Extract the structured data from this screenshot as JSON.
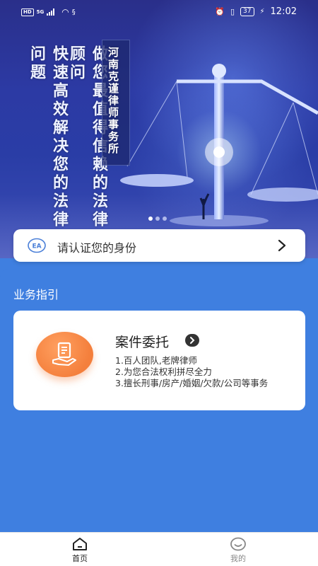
{
  "status_bar": {
    "network_badge": "HD",
    "network_type": "5G",
    "battery": "37",
    "time": "12:02"
  },
  "banner": {
    "slogan_left": "快速高效解决您的法律问题",
    "slogan_mid": "做您最值得信赖的法律顾问",
    "firm_name": "河南克谨律师事务所",
    "carousel_pages": 3,
    "carousel_active": 1
  },
  "identity": {
    "icon": "id-card-icon",
    "label": "请认证您的身份",
    "chevron_icon": "chevron-right-icon"
  },
  "business": {
    "section_title": "业务指引",
    "card": {
      "title": "案件委托",
      "icon": "document-hand-icon",
      "points": [
        "1.百人团队,老牌律师",
        "2.为您合法权利拼尽全力",
        "3.擅长刑事/房产/婚姻/欠款/公司等事务"
      ]
    }
  },
  "nav": {
    "items": [
      {
        "label": "首页",
        "icon": "home-icon",
        "active": true
      },
      {
        "label": "我的",
        "icon": "profile-face-icon",
        "active": false
      }
    ]
  },
  "colors": {
    "primary_blue": "#3f7fe0",
    "orange": "#f47f3c",
    "banner_dark": "#2a2f8a"
  }
}
